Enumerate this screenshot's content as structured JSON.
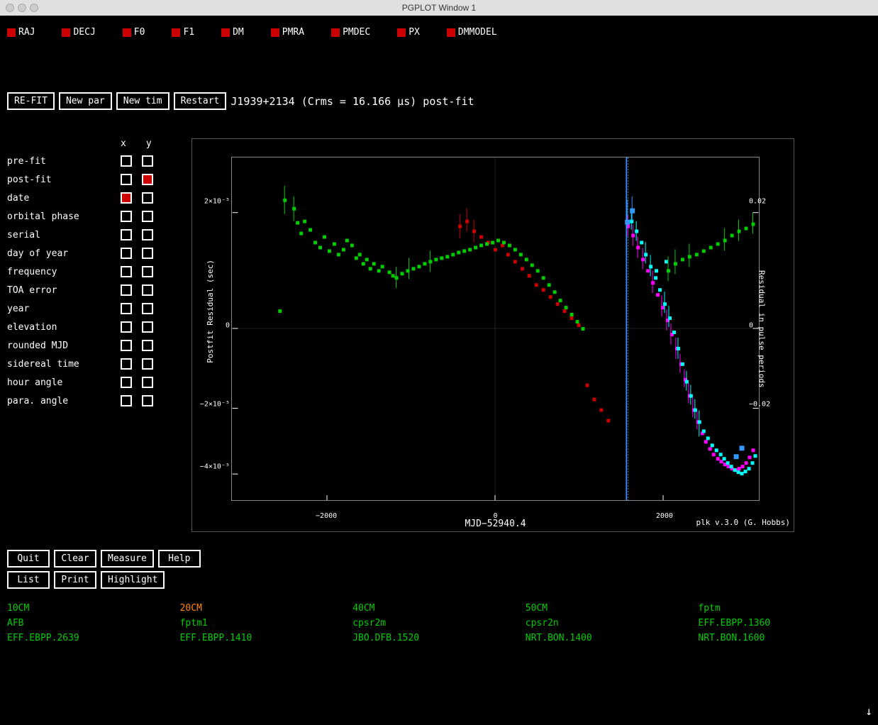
{
  "titlebar": {
    "title": "PGPLOT Window 1"
  },
  "param_toggles": [
    {
      "id": "RAJ",
      "label": "RAJ"
    },
    {
      "id": "DECJ",
      "label": "DECJ"
    },
    {
      "id": "F0",
      "label": "F0"
    },
    {
      "id": "F1",
      "label": "F1"
    },
    {
      "id": "DM",
      "label": "DM"
    },
    {
      "id": "PMRA",
      "label": "PMRA"
    },
    {
      "id": "PMDEC",
      "label": "PMDEC"
    },
    {
      "id": "PX",
      "label": "PX"
    },
    {
      "id": "DMMODEL",
      "label": "DMMODEL"
    }
  ],
  "buttons": {
    "refit": "RE-FIT",
    "new_par": "New par",
    "new_tim": "New tim",
    "restart": "Restart"
  },
  "plot_title": "J1939+2134  (Crms = 16.166 μs)  post-fit",
  "axis_rows": [
    {
      "label": "pre-fit",
      "x_filled": false,
      "y_filled": false
    },
    {
      "label": "post-fit",
      "x_filled": false,
      "y_filled": true
    },
    {
      "label": "date",
      "x_filled": true,
      "y_filled": false
    },
    {
      "label": "orbital phase",
      "x_filled": false,
      "y_filled": false
    },
    {
      "label": "serial",
      "x_filled": false,
      "y_filled": false
    },
    {
      "label": "day of year",
      "x_filled": false,
      "y_filled": false
    },
    {
      "label": "frequency",
      "x_filled": false,
      "y_filled": false
    },
    {
      "label": "TOA error",
      "x_filled": false,
      "y_filled": false
    },
    {
      "label": "year",
      "x_filled": false,
      "y_filled": false
    },
    {
      "label": "elevation",
      "x_filled": false,
      "y_filled": false
    },
    {
      "label": "rounded MJD",
      "x_filled": false,
      "y_filled": false
    },
    {
      "label": "sidereal time",
      "x_filled": false,
      "y_filled": false
    },
    {
      "label": "hour angle",
      "x_filled": false,
      "y_filled": false
    },
    {
      "label": "para. angle",
      "x_filled": false,
      "y_filled": false
    }
  ],
  "axis_headers": {
    "x": "x",
    "y": "y"
  },
  "y_axis_label": "Postfit Residual (sec)",
  "x_axis_label": "MJD−52940.4",
  "right_y_axis_label": "Residual in pulse periods",
  "y_ticks": [
    {
      "label": "2×10⁻⁵",
      "pct": 16
    },
    {
      "label": "0",
      "pct": 50
    },
    {
      "label": "−2×10⁻⁵",
      "pct": 73
    },
    {
      "label": "−4×10⁻⁵",
      "pct": 92
    }
  ],
  "x_ticks": [
    {
      "label": "−2000",
      "pct": 18
    },
    {
      "label": "0",
      "pct": 50
    },
    {
      "label": "2000",
      "pct": 82
    }
  ],
  "right_ticks": [
    {
      "label": "0.02",
      "pct": 16
    },
    {
      "label": "0",
      "pct": 50
    },
    {
      "label": "−0.02",
      "pct": 73
    }
  ],
  "plk_version": "plk v.3.0 (G. Hobbs)",
  "bottom_buttons": {
    "row1": [
      {
        "label": "Quit",
        "id": "quit"
      },
      {
        "label": "Clear",
        "id": "clear"
      },
      {
        "label": "Measure",
        "id": "measure"
      },
      {
        "label": "Help",
        "id": "help"
      }
    ],
    "row2": [
      {
        "label": "List",
        "id": "list"
      },
      {
        "label": "Print",
        "id": "print"
      },
      {
        "label": "Highlight",
        "id": "highlight"
      }
    ]
  },
  "bottom_labels": {
    "row1": [
      {
        "text": "10CM",
        "color": "green"
      },
      {
        "text": "20CM",
        "color": "orange"
      },
      {
        "text": "40CM",
        "color": "green"
      },
      {
        "text": "50CM",
        "color": "green"
      },
      {
        "text": "fptm",
        "color": "green"
      }
    ],
    "row2": [
      {
        "text": "AFB",
        "color": "green"
      },
      {
        "text": "fptm1",
        "color": "green"
      },
      {
        "text": "cpsr2m",
        "color": "green"
      },
      {
        "text": "cpsr2n",
        "color": "green"
      },
      {
        "text": "EFF.EBPP.1360",
        "color": "green"
      }
    ],
    "row3": [
      {
        "text": "EFF.EBPP.2639",
        "color": "green"
      },
      {
        "text": "EFF.EBPP.1410",
        "color": "green"
      },
      {
        "text": "JBO.DFB.1520",
        "color": "green"
      },
      {
        "text": "NRT.BON.1400",
        "color": "green"
      },
      {
        "text": "NRT.BON.1600",
        "color": "green"
      }
    ]
  }
}
